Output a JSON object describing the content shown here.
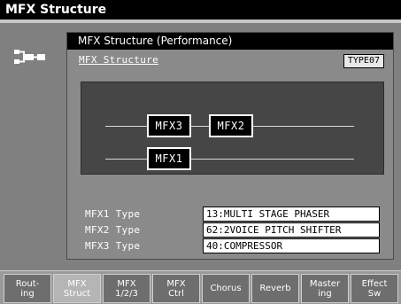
{
  "window": {
    "title": "MFX Structure"
  },
  "panel": {
    "header": "MFX Structure (Performance)",
    "subheading": "MFX Structure",
    "type_badge": "TYPE07"
  },
  "diagram": {
    "boxes": [
      {
        "id": "mfx3",
        "label": "MFX3"
      },
      {
        "id": "mfx2",
        "label": "MFX2"
      },
      {
        "id": "mfx1",
        "label": "MFX1"
      }
    ]
  },
  "types": [
    {
      "label": "MFX1 Type",
      "value": "13:MULTI STAGE PHASER"
    },
    {
      "label": "MFX2 Type",
      "value": "62:2VOICE PITCH SHIFTER"
    },
    {
      "label": "MFX3 Type",
      "value": "40:COMPRESSOR"
    }
  ],
  "tabs": [
    {
      "line1": "Rout-",
      "line2": "ing",
      "active": false
    },
    {
      "line1": "MFX",
      "line2": "Struct",
      "active": true
    },
    {
      "line1": "MFX",
      "line2": "1/2/3",
      "active": false
    },
    {
      "line1": "MFX",
      "line2": "Ctrl",
      "active": false
    },
    {
      "line1": "Chorus",
      "line2": "",
      "active": false
    },
    {
      "line1": "Reverb",
      "line2": "",
      "active": false
    },
    {
      "line1": "Master",
      "line2": "ing",
      "active": false
    },
    {
      "line1": "Effect",
      "line2": "Sw",
      "active": false
    }
  ],
  "icons": {
    "side_icon": "effects-routing-icon"
  }
}
